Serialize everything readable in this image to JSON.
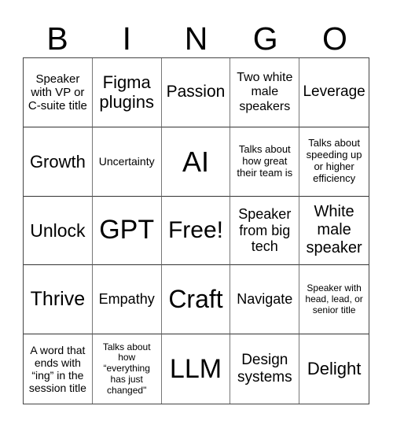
{
  "header": {
    "letters": [
      "B",
      "I",
      "N",
      "G",
      "O"
    ]
  },
  "board": {
    "cells": [
      [
        "Speaker with VP or C-suite title",
        "Figma plugins",
        "Passion",
        "Two white male speakers",
        "Leverage"
      ],
      [
        "Growth",
        "Uncertainty",
        "AI",
        "Talks about how great their team is",
        "Talks about speeding up or higher efficiency"
      ],
      [
        "Unlock",
        "GPT",
        "Free!",
        "Speaker from big tech",
        "White male speaker"
      ],
      [
        "Thrive",
        "Empathy",
        "Craft",
        "Navigate",
        "Speaker with head, lead, or senior title"
      ],
      [
        "A word that ends with “ing” in the session title",
        "Talks about how “everything has just changed\"",
        "LLM",
        "Design systems",
        "Delight"
      ]
    ]
  }
}
